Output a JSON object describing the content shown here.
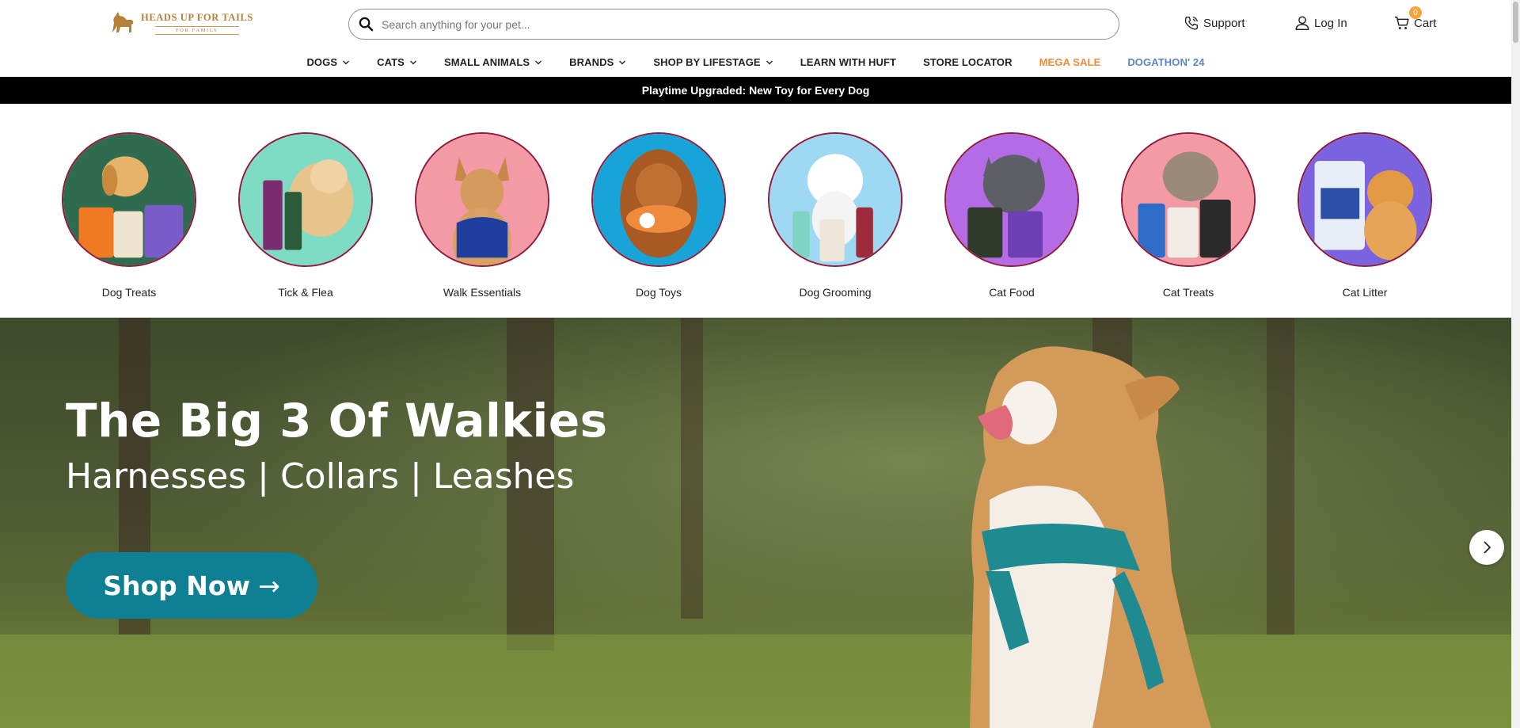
{
  "header": {
    "logo_main": "HEADS UP FOR TAILS",
    "logo_sub": "FOR FAMILY",
    "search_placeholder": "Search anything for your pet...",
    "support_label": "Support",
    "login_label": "Log In",
    "cart_label": "Cart",
    "cart_count": "0"
  },
  "nav": {
    "items": [
      {
        "label": "DOGS",
        "has_dropdown": true
      },
      {
        "label": "CATS",
        "has_dropdown": true
      },
      {
        "label": "SMALL ANIMALS",
        "has_dropdown": true
      },
      {
        "label": "BRANDS",
        "has_dropdown": true
      },
      {
        "label": "SHOP BY LIFESTAGE",
        "has_dropdown": true
      },
      {
        "label": "LEARN WITH HUFT",
        "has_dropdown": false
      },
      {
        "label": "STORE LOCATOR",
        "has_dropdown": false
      },
      {
        "label": "MEGA SALE",
        "has_dropdown": false
      },
      {
        "label": "DOGATHON' 24",
        "has_dropdown": false
      }
    ],
    "sale_color": "#f08a3c",
    "dogathon_color": "#5a86c2"
  },
  "announcement": "Playtime Upgraded: New Toy for Every Dog",
  "categories": [
    {
      "label": "Dog Treats",
      "bg": "#2f6b4f"
    },
    {
      "label": "Tick & Flea",
      "bg": "#7fdcc4"
    },
    {
      "label": "Walk Essentials",
      "bg": "#f49aa6"
    },
    {
      "label": "Dog Toys",
      "bg": "#18a4d8"
    },
    {
      "label": "Dog Grooming",
      "bg": "#9fd8f2"
    },
    {
      "label": "Cat Food",
      "bg": "#b46be6"
    },
    {
      "label": "Cat Treats",
      "bg": "#f39aa4"
    },
    {
      "label": "Cat Litter",
      "bg": "#7b63e0"
    }
  ],
  "hero": {
    "title": "The Big 3 Of Walkies",
    "subtitle": "Harnesses | Collars | Leashes",
    "cta_label": "Shop Now",
    "cta_color": "#0f7f93"
  },
  "colors": {
    "brand": "#b5813a",
    "category_border": "#8e1b3b",
    "announcement_bg": "#000000"
  }
}
